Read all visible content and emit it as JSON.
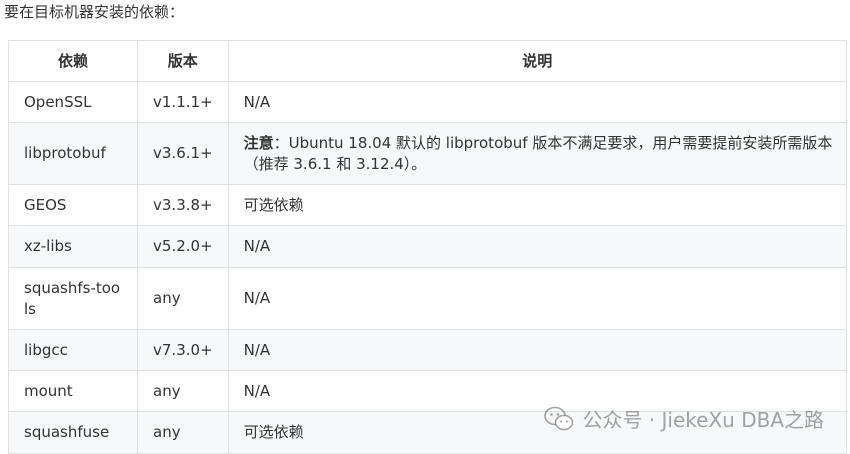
{
  "intro": "要在目标机器安装的依赖：",
  "table": {
    "headers": [
      "依赖",
      "版本",
      "说明"
    ],
    "rows": [
      {
        "dep": "OpenSSL",
        "ver": "v1.1.1+",
        "note": "N/A"
      },
      {
        "dep": "libprotobuf",
        "ver": "v3.6.1+",
        "note_label": "注意",
        "note": "：Ubuntu 18.04 默认的 libprotobuf 版本不满足要求，用户需要提前安装所需版本（推荐 3.6.1 和 3.12.4）。"
      },
      {
        "dep": "GEOS",
        "ver": "v3.3.8+",
        "note": "可选依赖"
      },
      {
        "dep": "xz-libs",
        "ver": "v5.2.0+",
        "note": "N/A"
      },
      {
        "dep": "squashfs-tools",
        "ver": "any",
        "note": "N/A"
      },
      {
        "dep": "libgcc",
        "ver": "v7.3.0+",
        "note": "N/A"
      },
      {
        "dep": "mount",
        "ver": "any",
        "note": "N/A"
      },
      {
        "dep": "squashfuse",
        "ver": "any",
        "note": "可选依赖"
      }
    ]
  },
  "watermark": {
    "icon": "wechat-icon",
    "text": "公众号 · JiekeXu DBA之路"
  }
}
